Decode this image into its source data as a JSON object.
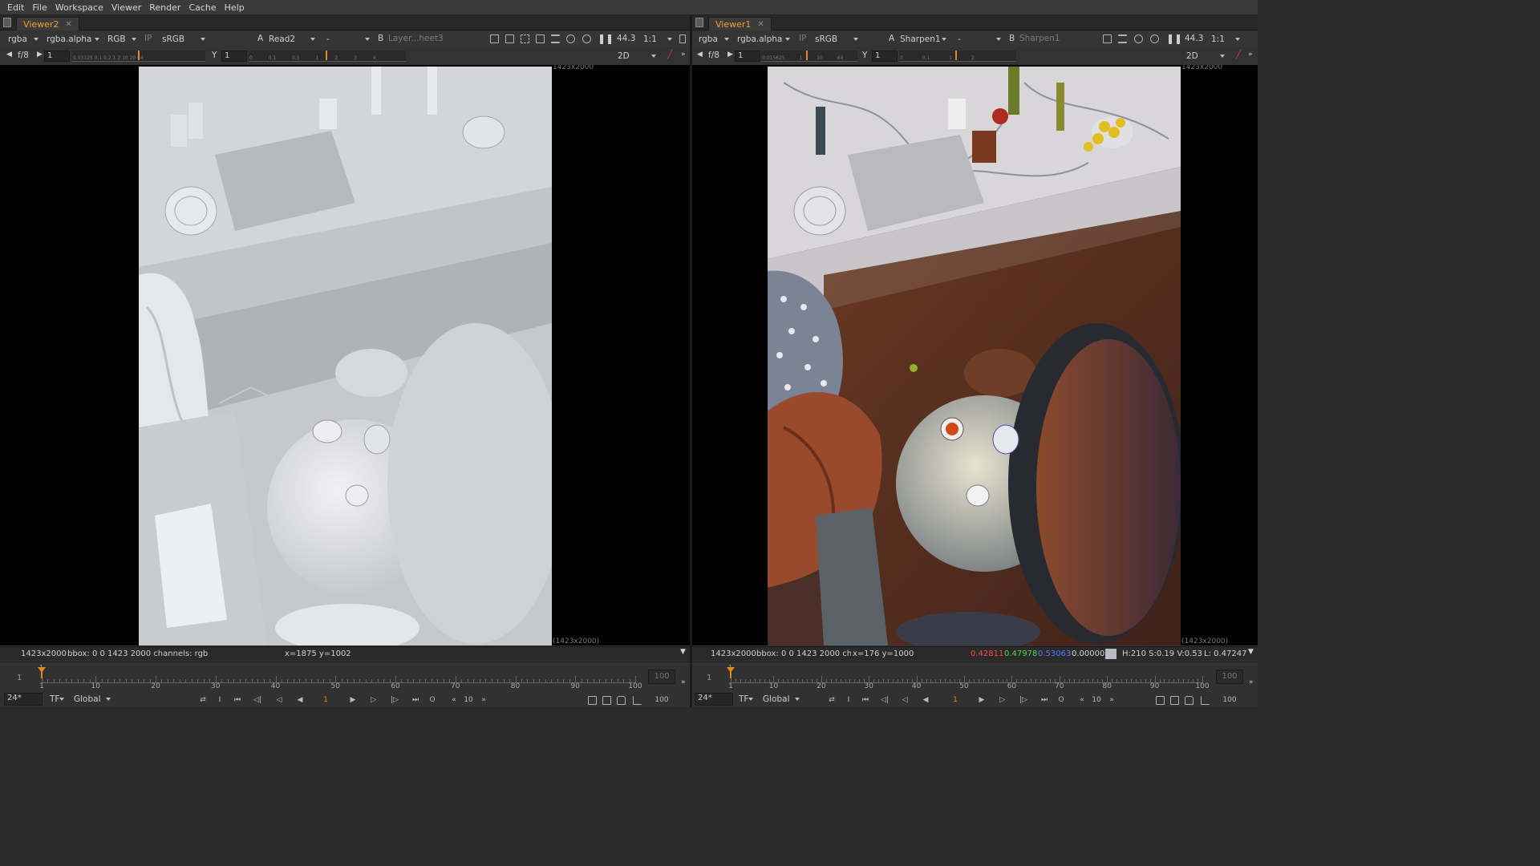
{
  "menu": [
    "Edit",
    "File",
    "Workspace",
    "Viewer",
    "Render",
    "Cache",
    "Help"
  ],
  "colors": {
    "accent": "#f0a030",
    "frame_marker": "#e08a20",
    "red_readout": "#ff4848",
    "green_readout": "#52d852",
    "blue_readout": "#5a78ff"
  },
  "viewers": [
    {
      "tab": "Viewer2",
      "channels": "rgba",
      "alpha": "rgba.alpha",
      "colorspace_mode": "RGB",
      "ip": "IP",
      "lut": "sRGB",
      "a_label": "A",
      "a_input": "Read2",
      "a_op": "-",
      "b_label": "B",
      "b_input": "Layer...heet3",
      "gain": "44.3",
      "zoom": "1:1",
      "fstop": "f/8",
      "frame": "1",
      "y_label": "Y",
      "y_value": "1",
      "gain_ticks": "0.03125 0.1 0.2 1 2 10 20 64",
      "gamma_ticks": "0 0.1 0.5 1 2 3 4",
      "view_mode": "2D",
      "res_top": "1423x2000",
      "res_bottom": "(1423x2000)",
      "info_res": "1423x2000",
      "info_bbox": "bbox: 0 0 1423 2000 channels: rgb",
      "info_xy": "x=1875 y=1002",
      "tl_start": "1",
      "tl_end": "100",
      "tl_marker": "1",
      "fps": "24*",
      "tf": "TF",
      "global": "Global",
      "cur_frame": "1",
      "step": "10",
      "end_frame": "100"
    },
    {
      "tab": "Viewer1",
      "channels": "rgba",
      "alpha": "rgba.alpha",
      "ip": "IP",
      "lut": "sRGB",
      "a_label": "A",
      "a_input": "Sharpen1",
      "a_op": "-",
      "b_label": "B",
      "b_input": "Sharpen1",
      "gain": "44.3",
      "zoom": "1:1",
      "fstop": "f/8",
      "frame": "1",
      "y_label": "Y",
      "y_value": "1",
      "gain_ticks": "0.015625 1 10 64",
      "gamma_ticks": "0 0.1 1 2",
      "view_mode": "2D",
      "res_top": "1423x2000",
      "res_bottom": "(1423x2000)",
      "info_res": "1423x2000",
      "info_bbox": "bbox: 0 0 1423 2000 ch",
      "info_xy": "x=176 y=1000",
      "pix_r": "0.42811",
      "pix_g": "0.47978",
      "pix_b": "0.53063",
      "pix_a": "0.00000",
      "pix_hsv": "H:210 S:0.19 V:0.53",
      "pix_l": "L: 0.47247",
      "tl_start": "1",
      "tl_end": "100",
      "tl_marker": "1",
      "fps": "24*",
      "tf": "TF",
      "global": "Global",
      "cur_frame": "1",
      "step": "10",
      "end_frame": "100"
    }
  ],
  "ruler_labels": [
    "1",
    "10",
    "20",
    "30",
    "40",
    "50",
    "60",
    "70",
    "80",
    "90",
    "100"
  ],
  "transport": {
    "in": "I",
    "out": "O",
    "prev_step": "«",
    "next_step": "»"
  }
}
